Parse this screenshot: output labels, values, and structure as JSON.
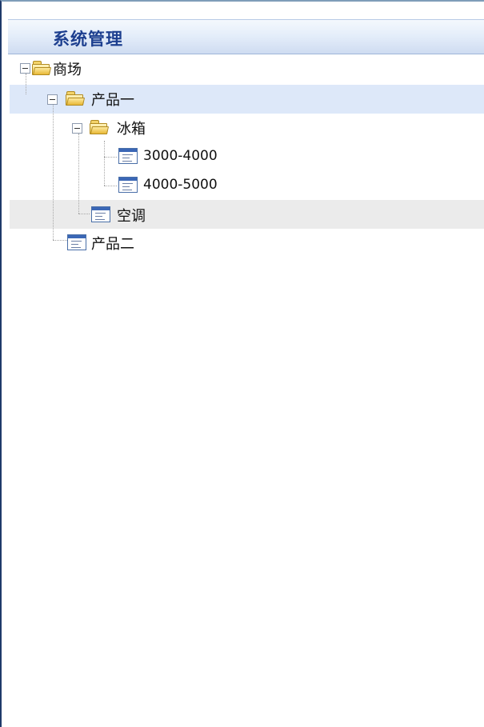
{
  "header": {
    "title": "系统管理"
  },
  "tree": {
    "root": {
      "label": "商场"
    },
    "product1": {
      "label": "产品一"
    },
    "fridge": {
      "label": "冰箱"
    },
    "range1": {
      "label": "3000-4000"
    },
    "range2": {
      "label": "4000-5000"
    },
    "ac": {
      "label": "空调"
    },
    "product2": {
      "label": "产品二"
    }
  },
  "colors": {
    "selected_row": "#dde8f9",
    "hover_row": "#ebebeb",
    "header_text": "#1d3f8f"
  },
  "icons": {
    "expander": "minus-box-icon",
    "folder": "folder-open-icon",
    "leaf": "document-list-icon"
  }
}
